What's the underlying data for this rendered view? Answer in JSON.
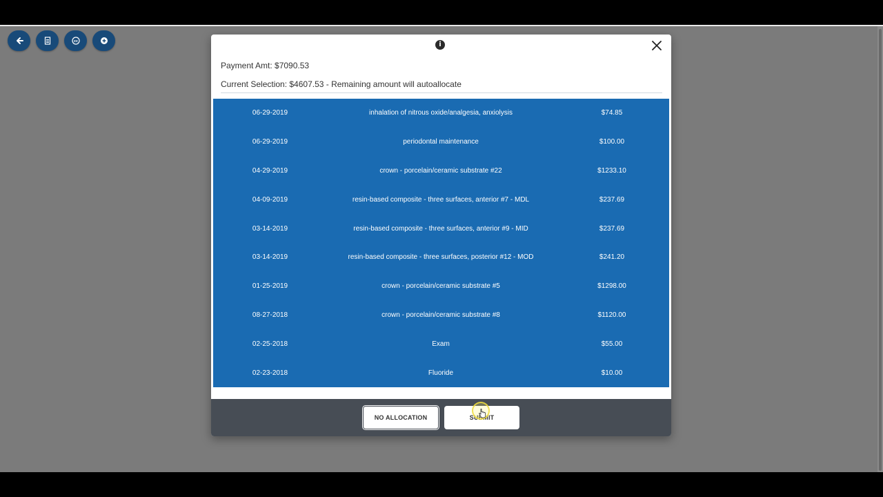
{
  "toolbar": {
    "buttons": [
      {
        "name": "back-button",
        "icon": "arrow-left-icon"
      },
      {
        "name": "document-button",
        "icon": "document-icon"
      },
      {
        "name": "cc-button",
        "icon": "cc-icon"
      },
      {
        "name": "add-button",
        "icon": "plus-circle-icon"
      }
    ],
    "color": "#184a79"
  },
  "modal": {
    "info_glyph": "i",
    "payment_amt": "Payment Amt: $7090.53",
    "current_selection": "Current Selection: $4607.53 - Remaining amount will autoallocate",
    "rows": [
      {
        "date": "06-29-2019",
        "description": "inhalation of nitrous oxide/analgesia, anxiolysis",
        "amount": "$74.85"
      },
      {
        "date": "06-29-2019",
        "description": "periodontal maintenance",
        "amount": "$100.00"
      },
      {
        "date": "04-29-2019",
        "description": "crown - porcelain/ceramic substrate #22",
        "amount": "$1233.10"
      },
      {
        "date": "04-09-2019",
        "description": "resin-based composite - three surfaces, anterior #7 - MDL",
        "amount": "$237.69"
      },
      {
        "date": "03-14-2019",
        "description": "resin-based composite - three surfaces, anterior #9 - MID",
        "amount": "$237.69"
      },
      {
        "date": "03-14-2019",
        "description": "resin-based composite - three surfaces, posterior #12 - MOD",
        "amount": "$241.20"
      },
      {
        "date": "01-25-2019",
        "description": "crown - porcelain/ceramic substrate #5",
        "amount": "$1298.00"
      },
      {
        "date": "08-27-2018",
        "description": "crown - porcelain/ceramic substrate #8",
        "amount": "$1120.00"
      },
      {
        "date": "02-25-2018",
        "description": "Exam",
        "amount": "$55.00"
      },
      {
        "date": "02-23-2018",
        "description": "Fluoride",
        "amount": "$10.00"
      }
    ],
    "selected_row_color": "#1a6bb2",
    "footer": {
      "no_allocation_label": "NO ALLOCATION",
      "submit_label": "SUBMIT"
    }
  }
}
